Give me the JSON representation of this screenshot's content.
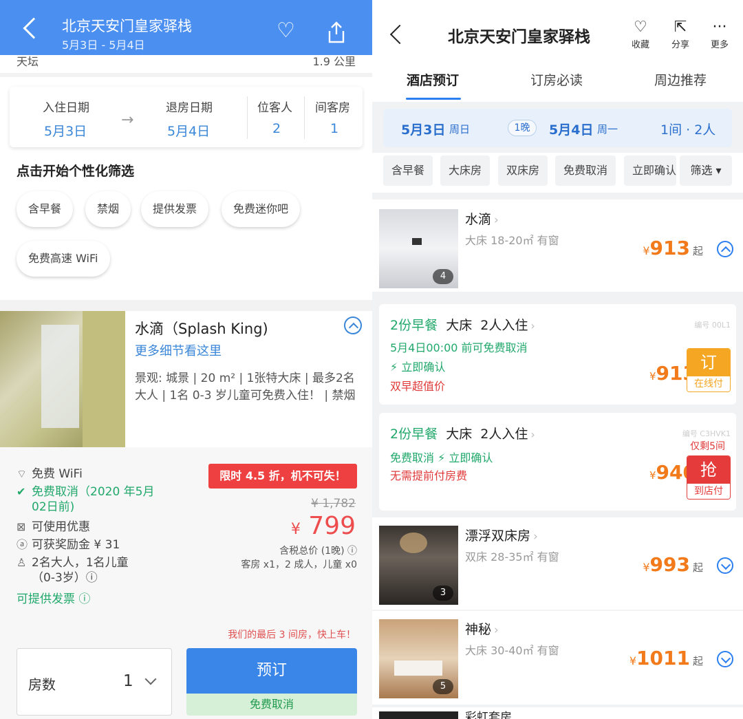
{
  "left": {
    "header": {
      "title": "北京天安门皇家驿栈",
      "dates": "5月3日 - 5月4日"
    },
    "strip": {
      "left": "天坛",
      "right": "1.9 公里"
    },
    "date_card": {
      "checkin_label": "入住日期",
      "checkin": "5月3日",
      "checkout_label": "退房日期",
      "checkout": "5月4日",
      "guests_label": "位客人",
      "guests": "2",
      "rooms_label": "间客房",
      "rooms": "1"
    },
    "filter": {
      "title": "点击开始个性化筛选",
      "pills": [
        "含早餐",
        "禁烟",
        "提供发票",
        "免费迷你吧",
        "免费高速 WiFi"
      ]
    },
    "room": {
      "name": "水滴（Splash King)",
      "link": "更多细节看这里",
      "desc": "景观: 城景 | 20 m² | 1张特大床 | 最多2名大人 | 1名 0-3 岁儿童可免费入住！ | 禁烟"
    },
    "details": {
      "features": [
        {
          "icon": "wifi-icon",
          "glyph": "⌔",
          "text": "免费 WiFi",
          "green": false
        },
        {
          "icon": "check-icon",
          "glyph": "✔",
          "text": "免费取消（2020 年5月",
          "green": true
        },
        {
          "icon": "",
          "glyph": "",
          "text": "02日前)",
          "green": true
        },
        {
          "icon": "coupon-icon",
          "glyph": "⊠",
          "text": "可使用优惠",
          "green": false
        },
        {
          "icon": "reward-icon",
          "glyph": "ⓐ",
          "text": "可获奖励金 ¥ 31",
          "green": false
        },
        {
          "icon": "people-icon",
          "glyph": "♙",
          "text": "2名大人，1名儿童",
          "green": false
        },
        {
          "icon": "",
          "glyph": "",
          "text": "（0-3岁）ⓘ",
          "green": false
        },
        {
          "icon": "",
          "glyph": "",
          "text": "可提供发票 ⓘ",
          "green": true
        }
      ],
      "promo": "限时 4.5 折，机不可失！",
      "original_price": "¥ 1,782",
      "currency": "¥",
      "price": "799",
      "price_note1": "含税总价 (1晚) ⓘ",
      "price_note2": "客房 x1，2 成人，儿童 x0",
      "last_rooms": "我们的最后 3 间房，快上车！",
      "qty_label": "房数",
      "qty": "1",
      "book_label": "预订",
      "free_cancel": "免费取消"
    }
  },
  "right": {
    "header": {
      "title": "北京天安门皇家驿栈",
      "actions": [
        {
          "glyph": "♡",
          "label": "收藏"
        },
        {
          "glyph": "⇱",
          "label": "分享"
        },
        {
          "glyph": "···",
          "label": "更多"
        }
      ]
    },
    "tabs": [
      "酒店预订",
      "订房必读",
      "周边推荐"
    ],
    "datebar": {
      "checkin": "5月3日",
      "checkin_wd": "周日",
      "nights": "1晚",
      "checkout": "5月4日",
      "checkout_wd": "周一",
      "summary": "1间 · 2人"
    },
    "chips": [
      "含早餐",
      "大床房",
      "双床房",
      "免费取消",
      "立即确认"
    ],
    "filter_label": "筛选 ▾",
    "rooms": [
      {
        "name": "水滴",
        "sub": "大床 18-20㎡  有窗",
        "price": "913",
        "suffix": "起",
        "photos": "4"
      },
      {
        "name": "漂浮双床房",
        "sub": "双床 28-35㎡  有窗",
        "price": "993",
        "suffix": "起",
        "photos": "3"
      },
      {
        "name": "神秘",
        "sub": "大床 30-40㎡  有窗",
        "price": "1011",
        "suffix": "起",
        "photos": "5"
      }
    ],
    "rates": [
      {
        "breakfast": "2份早餐",
        "bed": "大床",
        "occupancy": "2人入住",
        "line2": "5月4日00:00 前可免费取消",
        "line3": "⚡ 立即确认",
        "line4": "双早超值价",
        "code": "编号 00L1",
        "price": "913",
        "btn_top": "订",
        "btn_bottom": "在线付"
      },
      {
        "breakfast": "2份早餐",
        "bed": "大床",
        "occupancy": "2人入住",
        "line2": "免费取消   ⚡ 立即确认",
        "line3": "无需提前付房费",
        "code": "编号 C3HVK1",
        "remain": "仅剩5间",
        "price": "940",
        "btn_top": "抢",
        "btn_bottom": "到店付"
      }
    ],
    "bottom_partial": "彩虹套房"
  },
  "colors": {
    "left_header": "#4b8ff0",
    "link_blue": "#3a86d8",
    "price_red": "#ee4d4d",
    "price_orange": "#f27a1a",
    "green": "#21a86b",
    "orange_button": "#f5a623",
    "red_button": "#e63b3b"
  }
}
